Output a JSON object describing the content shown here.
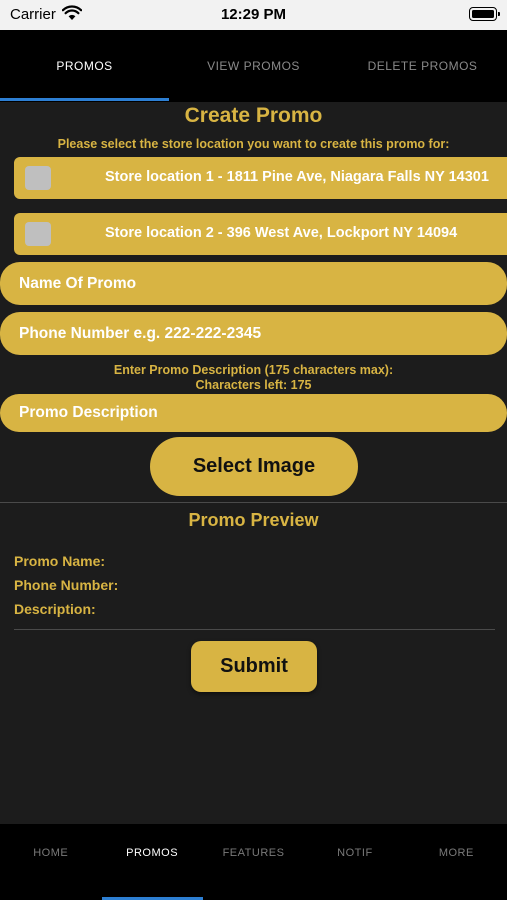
{
  "status_bar": {
    "carrier": "Carrier",
    "time": "12:29 PM"
  },
  "top_tabs": [
    {
      "label": "PROMOS",
      "active": true
    },
    {
      "label": "VIEW PROMOS",
      "active": false
    },
    {
      "label": "DELETE PROMOS",
      "active": false
    }
  ],
  "form": {
    "title": "Create Promo",
    "subtitle": "Please select the store location you want to create this promo for:",
    "stores": [
      {
        "label": "Store location 1 - 1811 Pine Ave, Niagara Falls NY 14301",
        "checked": false
      },
      {
        "label": "Store location 2 - 396 West Ave, Lockport NY 14094",
        "checked": false
      }
    ],
    "name_placeholder": "Name Of Promo",
    "phone_placeholder": "Phone Number e.g. 222-222-2345",
    "description_hint": "Enter Promo Description (175 characters max):",
    "characters_left": "Characters left: 175",
    "description_placeholder": "Promo Description",
    "select_image_label": "Select Image"
  },
  "preview": {
    "title": "Promo Preview",
    "name_label": "Promo Name:",
    "phone_label": "Phone Number:",
    "description_label": "Description:"
  },
  "submit_label": "Submit",
  "bottom_tabs": [
    {
      "label": "HOME",
      "active": false
    },
    {
      "label": "PROMOS",
      "active": true
    },
    {
      "label": "FEATURES",
      "active": false
    },
    {
      "label": "NOTIF",
      "active": false
    },
    {
      "label": "MORE",
      "active": false
    }
  ],
  "colors": {
    "accent": "#d8b443",
    "background": "#1c1c1c",
    "tab_bar": "#000000",
    "indicator": "#2d7fd3"
  }
}
